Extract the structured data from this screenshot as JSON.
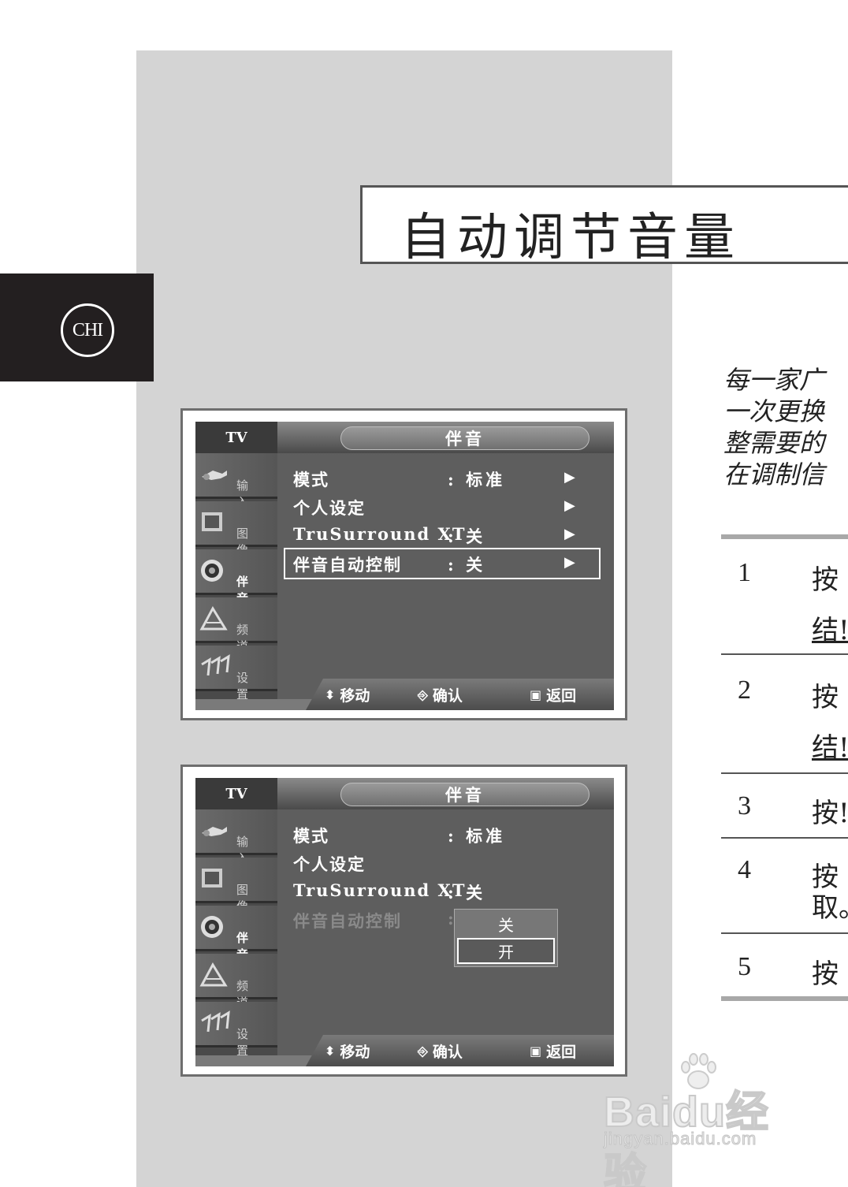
{
  "page": {
    "title": "自动调节音量",
    "lang_tab": "CHI"
  },
  "intro_lines": [
    "每一家广",
    "一次更换",
    "整需要的",
    "在调制信"
  ],
  "steps": [
    {
      "num": "1",
      "lines": [
        "按",
        "结!"
      ]
    },
    {
      "num": "2",
      "lines": [
        "按",
        "结!"
      ]
    },
    {
      "num": "3",
      "lines": [
        "按!"
      ]
    },
    {
      "num": "4",
      "lines": [
        "按",
        "取。"
      ]
    },
    {
      "num": "5",
      "lines": [
        "按"
      ]
    }
  ],
  "osd_common": {
    "tv_label": "TV",
    "menu_title": "伴音",
    "side_items": [
      {
        "label": "输 入",
        "icon": "input-icon"
      },
      {
        "label": "图 像",
        "icon": "picture-icon"
      },
      {
        "label": "伴 音",
        "icon": "speaker-icon"
      },
      {
        "label": "频 道",
        "icon": "channel-icon"
      },
      {
        "label": "设 置",
        "icon": "setup-icon"
      }
    ],
    "hints": {
      "move": "移动",
      "enter": "确认",
      "return": "返回"
    }
  },
  "screen1": {
    "rows": [
      {
        "name": "模式",
        "value": ": 标准",
        "arrow": "▶"
      },
      {
        "name": "个人设定",
        "value": "",
        "arrow": "▶"
      },
      {
        "name": "TruSurround XT",
        "value": ": 关",
        "arrow": "▶"
      },
      {
        "name": "伴音自动控制",
        "value": ": 关",
        "arrow": "▶"
      }
    ]
  },
  "screen2": {
    "rows": [
      {
        "name": "模式",
        "value": ": 标准"
      },
      {
        "name": "个人设定",
        "value": ""
      },
      {
        "name": "TruSurround XT",
        "value": ": 关"
      },
      {
        "name": "伴音自动控制",
        "value": ":"
      }
    ],
    "dropdown": {
      "options": [
        "关",
        "开"
      ],
      "selected": "开"
    }
  },
  "watermark": {
    "main": "Baidu经验",
    "sub": "jingyan.baidu.com"
  }
}
